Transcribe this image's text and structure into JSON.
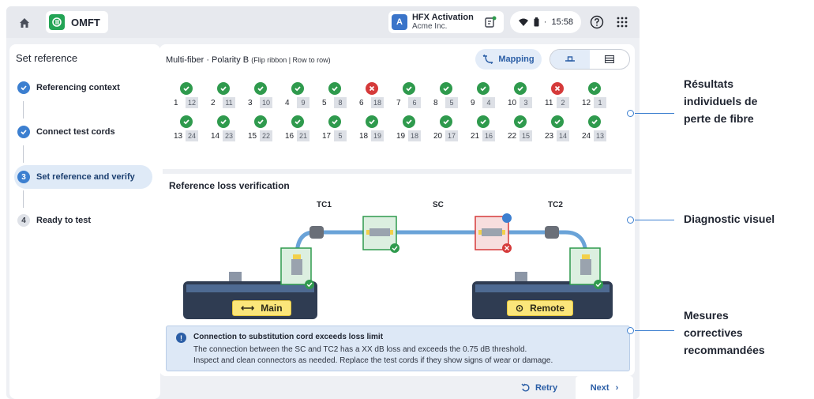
{
  "topbar": {
    "app_name": "OMFT",
    "account_title": "HFX Activation",
    "account_sub": "Acme Inc.",
    "avatar_letter": "A",
    "time": "15:58",
    "separator": "·"
  },
  "sidebar": {
    "title": "Set reference",
    "steps": [
      {
        "label": "Referencing context",
        "state": "done",
        "marker": ""
      },
      {
        "label": "Connect test cords",
        "state": "done",
        "marker": ""
      },
      {
        "label": "Set reference and verify",
        "state": "active",
        "marker": "3"
      },
      {
        "label": "Ready to test",
        "state": "todo",
        "marker": "4"
      }
    ]
  },
  "header": {
    "config": "Multi-fiber · Polarity B",
    "mode": "(Flip ribbon | Row to row)",
    "mapping_label": "Mapping"
  },
  "fibers": [
    {
      "num": "1",
      "pair": "12",
      "status": "pass"
    },
    {
      "num": "2",
      "pair": "11",
      "status": "pass"
    },
    {
      "num": "3",
      "pair": "10",
      "status": "pass"
    },
    {
      "num": "4",
      "pair": "9",
      "status": "pass"
    },
    {
      "num": "5",
      "pair": "8",
      "status": "pass"
    },
    {
      "num": "6",
      "pair": "18",
      "status": "fail"
    },
    {
      "num": "7",
      "pair": "6",
      "status": "pass"
    },
    {
      "num": "8",
      "pair": "5",
      "status": "pass"
    },
    {
      "num": "9",
      "pair": "4",
      "status": "pass"
    },
    {
      "num": "10",
      "pair": "3",
      "status": "pass"
    },
    {
      "num": "11",
      "pair": "2",
      "status": "fail"
    },
    {
      "num": "12",
      "pair": "1",
      "status": "pass"
    },
    {
      "num": "13",
      "pair": "24",
      "status": "pass"
    },
    {
      "num": "14",
      "pair": "23",
      "status": "pass"
    },
    {
      "num": "15",
      "pair": "22",
      "status": "pass"
    },
    {
      "num": "16",
      "pair": "21",
      "status": "pass"
    },
    {
      "num": "17",
      "pair": "5",
      "status": "pass"
    },
    {
      "num": "18",
      "pair": "19",
      "status": "pass"
    },
    {
      "num": "19",
      "pair": "18",
      "status": "pass"
    },
    {
      "num": "20",
      "pair": "17",
      "status": "pass"
    },
    {
      "num": "21",
      "pair": "16",
      "status": "pass"
    },
    {
      "num": "22",
      "pair": "15",
      "status": "pass"
    },
    {
      "num": "23",
      "pair": "14",
      "status": "pass"
    },
    {
      "num": "24",
      "pair": "13",
      "status": "pass"
    }
  ],
  "verification": {
    "title": "Reference loss verification",
    "tc1": "TC1",
    "sc": "SC",
    "tc2": "TC2",
    "main_label": "Main",
    "remote_label": "Remote",
    "colors": {
      "pass": "#2f9a4d",
      "fail": "#d53a3a",
      "cable": "#6aa3d8",
      "tag": "#fbe67a"
    }
  },
  "notice": {
    "title": "Connection to substitution cord exceeds loss limit",
    "line1": "The connection between the SC and TC2 has a XX dB loss and exceeds the 0.75 dB threshold.",
    "line2": "Inspect and clean connectors as needed. Replace the test cords if they show signs of wear or damage."
  },
  "footer": {
    "retry_label": "Retry",
    "next_label": "Next"
  },
  "callouts": {
    "c1": [
      "Résultats",
      "individuels de",
      "perte de fibre"
    ],
    "c2": [
      "Diagnostic visuel"
    ],
    "c3": [
      "Mesures",
      "correctives",
      "recommandées"
    ]
  }
}
